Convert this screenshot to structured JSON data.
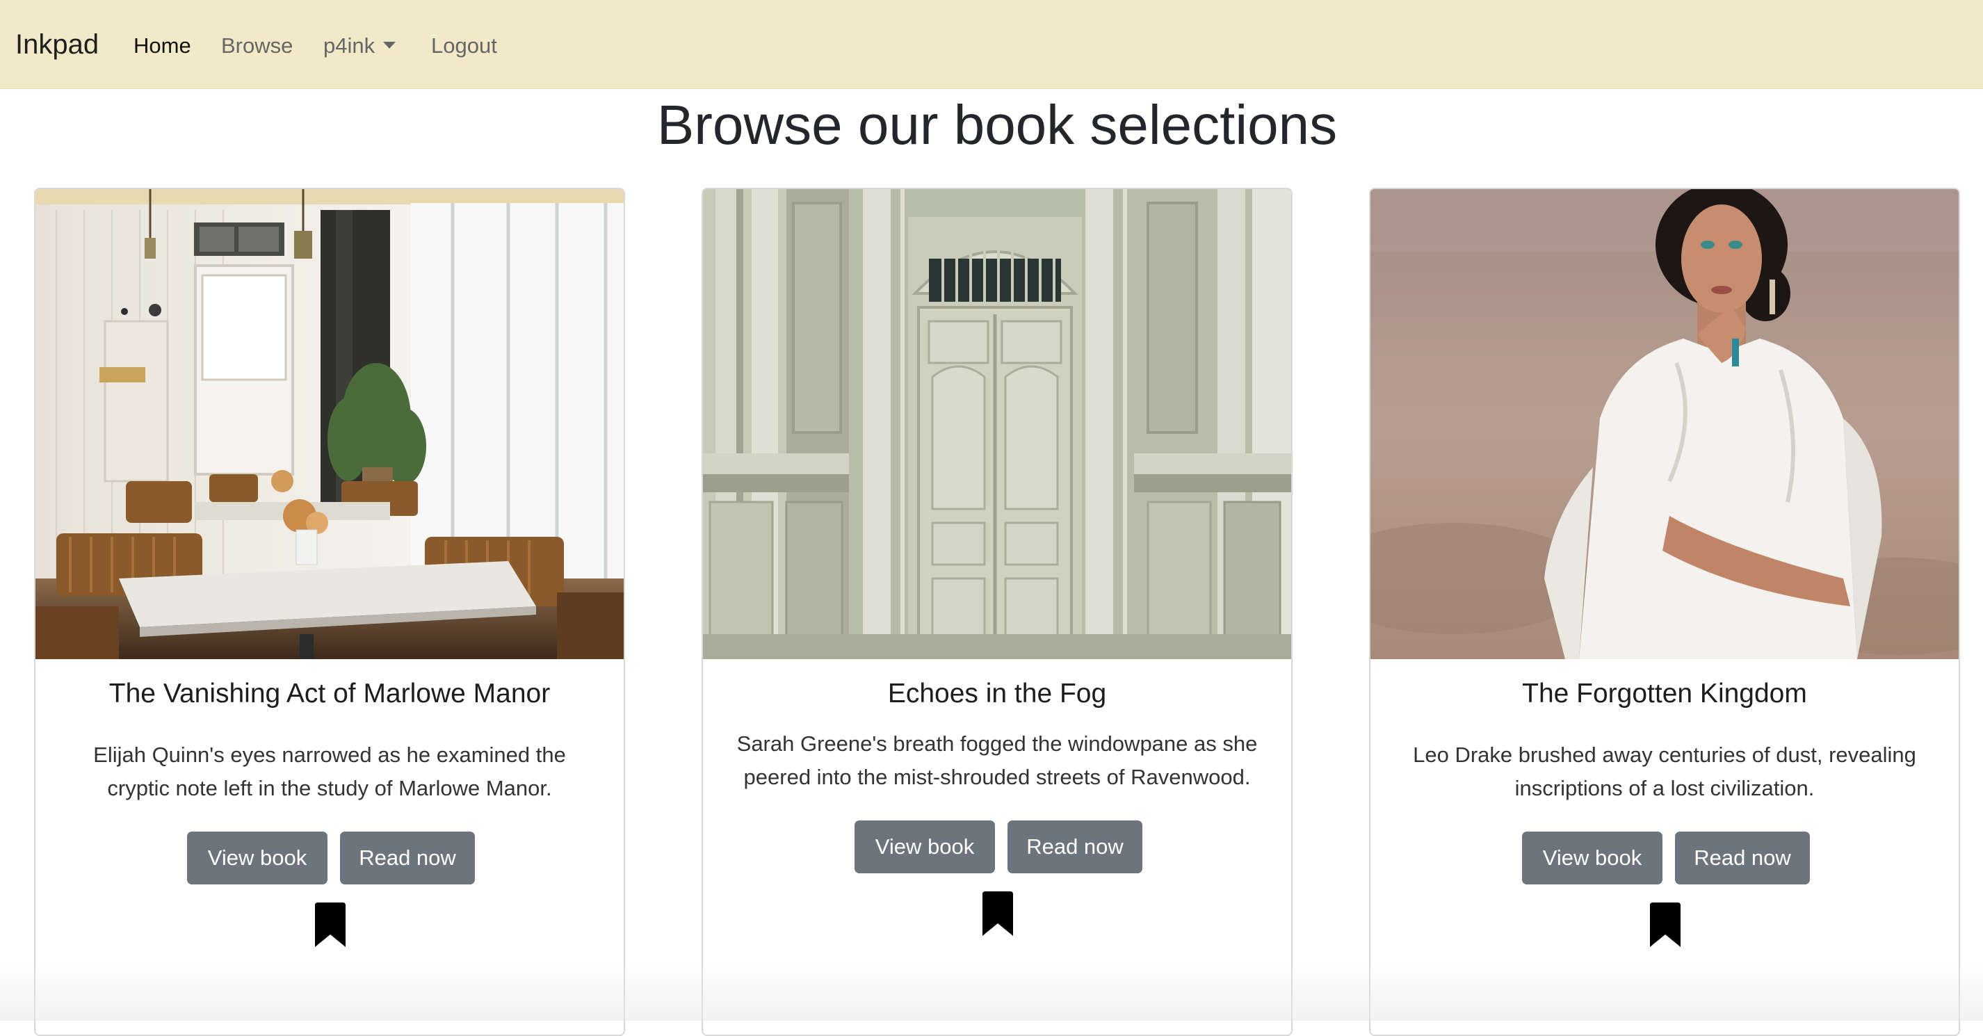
{
  "navbar": {
    "brand": "Inkpad",
    "links": {
      "home": "Home",
      "browse": "Browse",
      "user": "p4ink",
      "logout": "Logout"
    }
  },
  "page": {
    "title": "Browse our book selections"
  },
  "books": [
    {
      "title": "The Vanishing Act of Marlowe Manor",
      "excerpt": "Elijah Quinn's eyes narrowed as he examined the cryptic note left in the study of Marlowe Manor.",
      "view_label": "View book",
      "read_label": "Read now"
    },
    {
      "title": "Echoes in the Fog",
      "excerpt": "Sarah Greene's breath fogged the windowpane as she peered into the mist-shrouded streets of Ravenwood.",
      "view_label": "View book",
      "read_label": "Read now"
    },
    {
      "title": "The Forgotten Kingdom",
      "excerpt": "Leo Drake brushed away centuries of dust, revealing inscriptions of a lost civilization.",
      "view_label": "View book",
      "read_label": "Read now"
    }
  ],
  "colors": {
    "navbar_bg": "#f2e9c8",
    "button_bg": "#6c757d",
    "button_text": "#ffffff"
  },
  "icons": {
    "user_menu": "caret-down-icon",
    "bookmark": "bookmark-icon"
  }
}
